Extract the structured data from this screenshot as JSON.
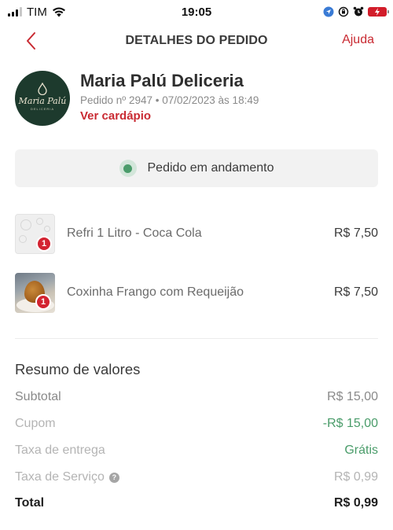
{
  "status_bar": {
    "carrier": "TIM",
    "time": "19:05",
    "battery_color": "#d21d2a"
  },
  "header": {
    "title": "DETALHES DO PEDIDO",
    "help_label": "Ajuda",
    "back_icon": "chevron-left-icon"
  },
  "store": {
    "name": "Maria Palú Deliceria",
    "logo_text": "Maria Palú",
    "logo_sub": "DELICERIA",
    "meta": "Pedido nº 2947 • 07/02/2023 às 18:49",
    "menu_link": "Ver cardápio"
  },
  "order_status": {
    "label": "Pedido em andamento",
    "color": "#4a9c6a"
  },
  "items": [
    {
      "quantity": "1",
      "name": "Refri 1 Litro - Coca Cola",
      "price": "R$ 7,50"
    },
    {
      "quantity": "1",
      "name": "Coxinha Frango com Requeijão",
      "price": "R$ 7,50"
    }
  ],
  "summary": {
    "title": "Resumo de valores",
    "subtotal": {
      "label": "Subtotal",
      "value": "R$ 15,00"
    },
    "coupon": {
      "label": "Cupom",
      "value": "-R$ 15,00"
    },
    "delivery": {
      "label": "Taxa de entrega",
      "value": "Grátis"
    },
    "service": {
      "label": "Taxa de Serviço",
      "value": "R$ 0,99"
    },
    "total": {
      "label": "Total",
      "value": "R$ 0,99"
    }
  },
  "colors": {
    "accent": "#c92a32",
    "success": "#4a9c6a",
    "badge": "#d32331"
  }
}
